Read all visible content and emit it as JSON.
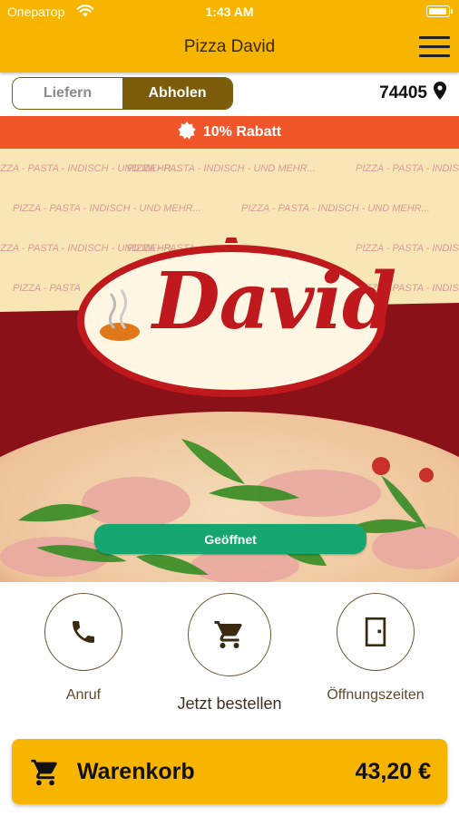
{
  "status_bar": {
    "carrier": "Оператор",
    "time": "1:43 AM"
  },
  "header": {
    "title": "Pizza David"
  },
  "order_mode": {
    "delivery_label": "Liefern",
    "pickup_label": "Abholen",
    "selected": "Abholen"
  },
  "location": {
    "zip": "74405"
  },
  "discount": {
    "text": "10% Rabatt"
  },
  "hero": {
    "tagline": "PIZZA - PASTA - INDISCH - UND MEHR...",
    "tagline_fragment": "PIZZA - PASTA",
    "logo_text": "David",
    "open_status": "Geöffnet"
  },
  "actions": [
    {
      "label": "Anruf",
      "icon": "phone-icon"
    },
    {
      "label": "Jetzt bestellen",
      "icon": "cart-icon"
    },
    {
      "label": "Öffnungszeiten",
      "icon": "door-icon"
    }
  ],
  "cart": {
    "label": "Warenkorb",
    "total": "43,20 €"
  },
  "colors": {
    "brand_yellow": "#f7b500",
    "discount_orange": "#f0562a",
    "pickup_brown": "#7a5c0b",
    "open_green": "#16a66f",
    "logo_red": "#c0191d"
  }
}
